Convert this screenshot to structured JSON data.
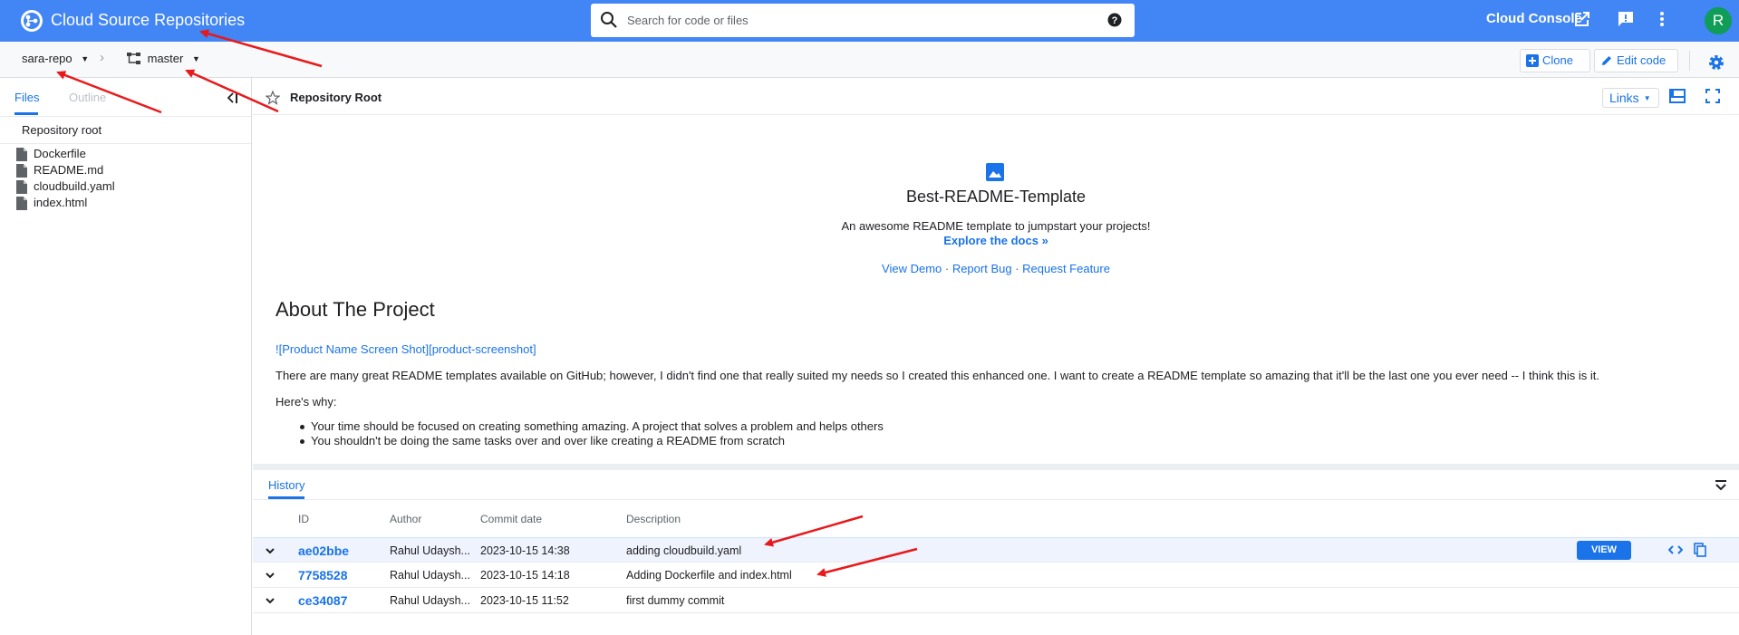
{
  "app": {
    "title": "Cloud Source Repositories"
  },
  "search": {
    "placeholder": "Search for code or files"
  },
  "topbar": {
    "console_label": "Cloud Console",
    "avatar_initial": "R"
  },
  "breadcrumb": {
    "repo": "sara-repo",
    "branch": "master"
  },
  "toolbar": {
    "clone_label": "Clone",
    "edit_label": "Edit code"
  },
  "sidebar": {
    "tabs": [
      "Files",
      "Outline"
    ],
    "root_label": "Repository root",
    "files": [
      "Dockerfile",
      "README.md",
      "cloudbuild.yaml",
      "index.html"
    ]
  },
  "main": {
    "header_title": "Repository Root",
    "links_label": "Links"
  },
  "readme": {
    "title": "Best-README-Template",
    "tagline": "An awesome README template to jumpstart your projects!",
    "docs_link": "Explore the docs »",
    "links": [
      "View Demo",
      "Report Bug",
      "Request Feature"
    ],
    "link_separator": " · ",
    "about_heading": "About The Project",
    "screenshot_ref": "![Product Name Screen Shot][product-screenshot]",
    "paragraph": "There are many great README templates available on GitHub; however, I didn't find one that really suited my needs so I created this enhanced one. I want to create a README template so amazing that it'll be the last one you ever need -- I think this is it.",
    "why": "Here's why:",
    "bullets": [
      "Your time should be focused on creating something amazing. A project that solves a problem and helps others",
      "You shouldn't be doing the same tasks over and over like creating a README from scratch"
    ]
  },
  "history": {
    "tab_label": "History",
    "columns": [
      "ID",
      "Author",
      "Commit date",
      "Description"
    ],
    "view_label": "VIEW",
    "rows": [
      {
        "id": "ae02bbe",
        "author": "Rahul Udaysh...",
        "date": "2023-10-15 14:38",
        "description": "adding cloudbuild.yaml"
      },
      {
        "id": "7758528",
        "author": "Rahul Udaysh...",
        "date": "2023-10-15 14:18",
        "description": "Adding Dockerfile and index.html"
      },
      {
        "id": "ce34087",
        "author": "Rahul Udaysh...",
        "date": "2023-10-15 11:52",
        "description": "first dummy commit"
      }
    ]
  },
  "colors": {
    "brand": "#4285f4",
    "accent": "#1a73e8",
    "annotation": "#e8191b",
    "avatar": "#0f9d58"
  },
  "icons": [
    "source-repos-logo-icon",
    "search-icon",
    "help-icon",
    "external-link-icon",
    "feedback-icon",
    "more-vert-icon",
    "settings-icon",
    "star-icon",
    "image-icon",
    "copy-icon",
    "code-icon"
  ]
}
